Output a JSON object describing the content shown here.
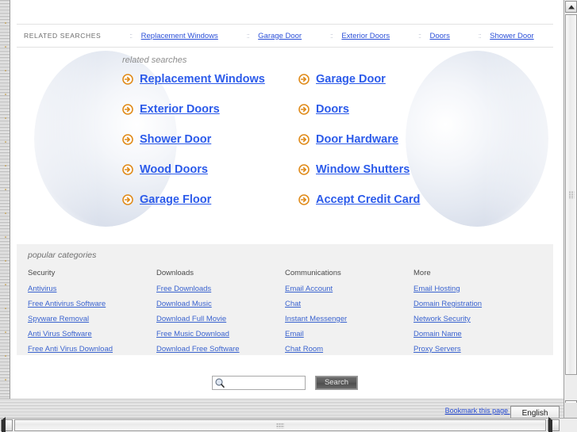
{
  "colors": {
    "link_blue": "#2c5bea",
    "small_link_blue": "#3a63cf",
    "arrow_orange": "#e08b1a",
    "panel_gray": "#f1f1f1",
    "muted_text": "#6d6d6d"
  },
  "top_strip": {
    "label": "RELATED SEARCHES",
    "separator": "::",
    "links": [
      "Replacement Windows",
      "Garage Door",
      "Exterior Doors",
      "Doors",
      "Shower Door"
    ]
  },
  "hero": {
    "title": "related searches",
    "links": [
      "Replacement Windows",
      "Garage Door",
      "Exterior Doors",
      "Doors",
      "Shower Door",
      "Door Hardware",
      "Wood Doors",
      "Window Shutters",
      "Garage Floor",
      "Accept Credit Card"
    ]
  },
  "popular_categories": {
    "title": "popular categories",
    "columns": [
      {
        "heading": "Security",
        "links": [
          "Antivirus",
          "Free Antivirus Software",
          "Spyware Removal",
          "Anti Virus Software",
          "Free Anti Virus Download"
        ]
      },
      {
        "heading": "Downloads",
        "links": [
          "Free Downloads",
          "Download Music",
          "Download Full Movie",
          "Free Music Download",
          "Download Free Software"
        ]
      },
      {
        "heading": "Communications",
        "links": [
          "Email Account",
          "Chat",
          "Instant Messenger",
          "Email",
          "Chat Room"
        ]
      },
      {
        "heading": "More",
        "links": [
          "Email Hosting",
          "Domain Registration",
          "Network Security",
          "Domain Name",
          "Proxy Servers"
        ]
      }
    ]
  },
  "search": {
    "value": "",
    "placeholder": "",
    "button_label": "Search",
    "icon": "magnifier-icon"
  },
  "footer": {
    "bookmark_label": "Bookmark this page |",
    "language": "English"
  },
  "icons": {
    "arrow": "arrow-circle-right-icon",
    "scroll_up": "triangle-up-icon",
    "scroll_down": "triangle-down-icon",
    "scroll_left": "triangle-left-icon",
    "scroll_right": "triangle-right-icon"
  }
}
